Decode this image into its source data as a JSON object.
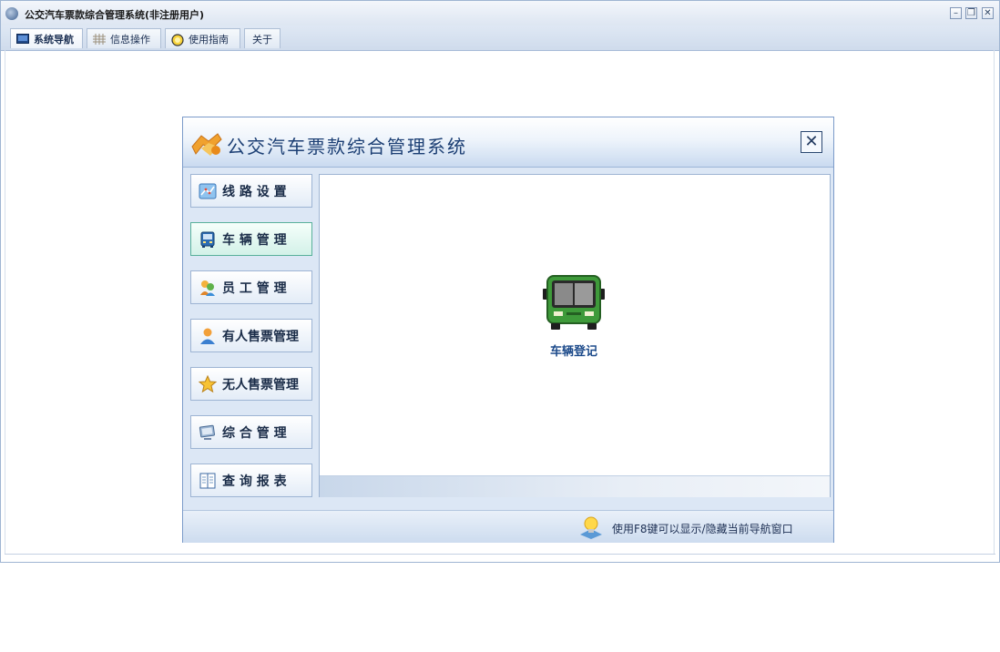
{
  "window": {
    "title": "公交汽车票款综合管理系统(非注册用户)",
    "minimize_glyph": "–",
    "restore_glyph": "❐",
    "close_glyph": "✕"
  },
  "tabs": [
    {
      "label": "系统导航",
      "icon": "navigation-icon",
      "active": true
    },
    {
      "label": "信息操作",
      "icon": "grid-icon",
      "active": false
    },
    {
      "label": "使用指南",
      "icon": "guide-icon",
      "active": false
    },
    {
      "label": "关于",
      "icon": "",
      "active": false
    }
  ],
  "dialog": {
    "title": "公交汽车票款综合管理系统",
    "close_glyph": "✕",
    "nav": [
      {
        "label": "线 路 设 置",
        "icon": "route-map-icon",
        "active": false
      },
      {
        "label": "车 辆 管 理",
        "icon": "bus-icon",
        "active": true
      },
      {
        "label": "员 工 管 理",
        "icon": "staff-icon",
        "active": false
      },
      {
        "label": "有人售票管理",
        "icon": "conductor-icon",
        "active": false
      },
      {
        "label": "无人售票管理",
        "icon": "star-icon",
        "active": false
      },
      {
        "label": "综 合 管 理",
        "icon": "monitor-icon",
        "active": false
      },
      {
        "label": "查 询 报 表",
        "icon": "report-icon",
        "active": false
      }
    ],
    "content": {
      "items": [
        {
          "label": "车辆登记",
          "icon": "bus-icon"
        }
      ]
    },
    "status_tip": "使用F8键可以显示/隐藏当前导航窗口"
  },
  "colors": {
    "accent": "#1c3f74",
    "active_nav": "#58b09a",
    "bus_green": "#3e9a3a"
  }
}
